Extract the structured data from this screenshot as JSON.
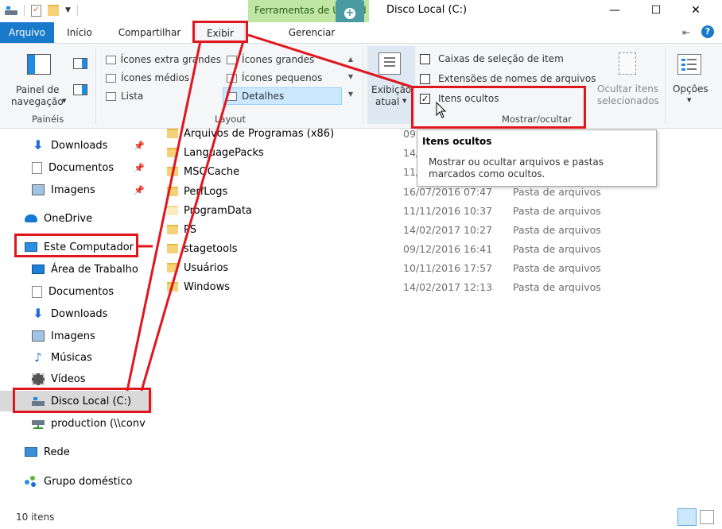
{
  "titlebar": {
    "context_tab": "Ferramentas de Unidade",
    "title": "Disco Local (C:)",
    "minimize": "—",
    "maximize": "☐",
    "close": "✕"
  },
  "tabs": {
    "arquivo": "Arquivo",
    "inicio": "Início",
    "compartilhar": "Compartilhar",
    "exibir": "Exibir",
    "gerenciar": "Gerenciar"
  },
  "ribbon": {
    "panes_group": {
      "label": "Painéis",
      "nav_pane_line1": "Painel de",
      "nav_pane_line2": "navegação"
    },
    "layout_group": {
      "label": "Layout",
      "items": {
        "extra_large": "Ícones extra grandes",
        "large": "Ícones grandes",
        "medium": "Ícones médios",
        "small": "Ícones pequenos",
        "list": "Lista",
        "details": "Detalhes"
      }
    },
    "current_view": {
      "line1": "Exibição",
      "line2": "atual"
    },
    "show_hide_group": {
      "label": "Mostrar/ocultar",
      "item_checkboxes": "Caixas de seleção de item",
      "extensions": "Extensões de nomes de arquivos",
      "hidden_items": "Itens ocultos",
      "hide_selected_line1": "Ocultar itens",
      "hide_selected_line2": "selecionados"
    },
    "options": "Opções"
  },
  "tooltip": {
    "title": "Itens ocultos",
    "line1": "Mostrar ou ocultar arquivos e pastas",
    "line2": "marcados como ocultos."
  },
  "nav": {
    "downloads_q": "Downloads",
    "documentos_q": "Documentos",
    "imagens_q": "Imagens",
    "onedrive": "OneDrive",
    "este_computador": "Este Computador",
    "area_trabalho": "Área de Trabalho",
    "documentos": "Documentos",
    "downloads": "Downloads",
    "imagens": "Imagens",
    "musicas": "Músicas",
    "videos": "Vídeos",
    "disco_local": "Disco Local (C:)",
    "production": "production (\\\\conv",
    "rede": "Rede",
    "grupo": "Grupo doméstico"
  },
  "files": [
    {
      "name": "Arquivos de Programas (x86)",
      "date": "09",
      "type": ""
    },
    {
      "name": "LanguagePacks",
      "date": "14/",
      "type": ""
    },
    {
      "name": "MSOCache",
      "date": "11/",
      "type": ""
    },
    {
      "name": "PerfLogs",
      "date": "16/07/2016 07:47",
      "type": "Pasta de arquivos"
    },
    {
      "name": "ProgramData",
      "date": "11/11/2016 10:37",
      "type": "Pasta de arquivos"
    },
    {
      "name": "PS",
      "date": "14/02/2017 10:27",
      "type": "Pasta de arquivos"
    },
    {
      "name": "stagetools",
      "date": "09/12/2016 16:41",
      "type": "Pasta de arquivos"
    },
    {
      "name": "Usuários",
      "date": "10/11/2016 17:57",
      "type": "Pasta de arquivos"
    },
    {
      "name": "Windows",
      "date": "14/02/2017 12:13",
      "type": "Pasta de arquivos"
    }
  ],
  "status": {
    "count": "10 itens"
  },
  "colors": {
    "accent": "#1979ca",
    "highlight": "#e0161e",
    "context_tab": "#bfe6a3"
  }
}
